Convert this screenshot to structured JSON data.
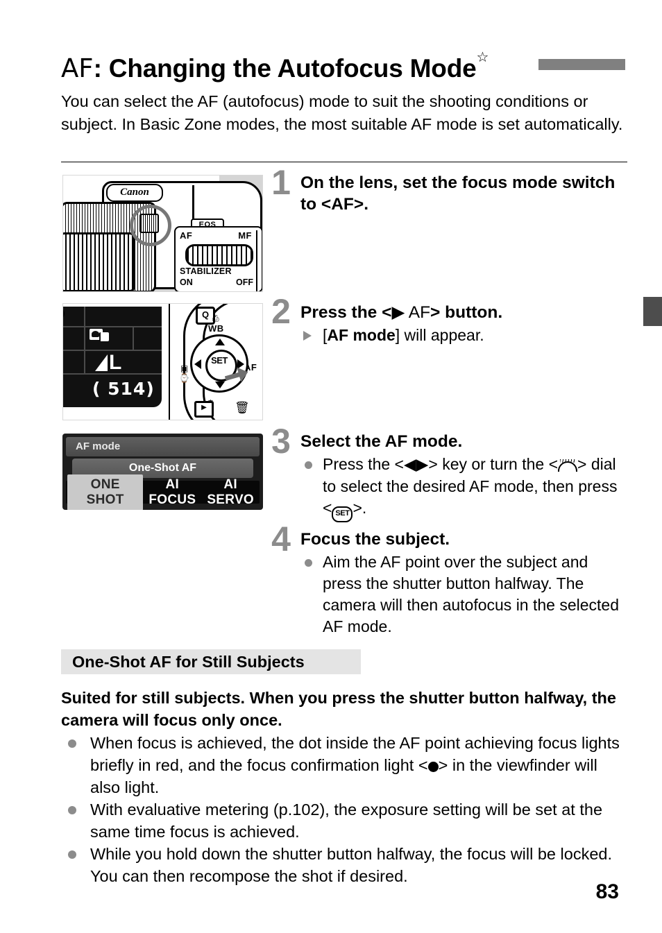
{
  "header": {
    "af_glyph": "AF",
    "title": ": Changing the Autofocus Mode",
    "star": "☆"
  },
  "intro": "You can select the AF (autofocus) mode to suit the shooting conditions or subject. In Basic Zone modes, the most suitable AF mode is set automatically.",
  "steps": [
    {
      "number": "1",
      "heading": "On the lens, set the focus mode switch to <AF>.",
      "body": []
    },
    {
      "number": "2",
      "heading_pre": "Press the <",
      "heading_arrow": "▶",
      "heading_af": " AF",
      "heading_post": "> button.",
      "body": [
        {
          "marker": "triangle",
          "pre": "[",
          "bold": "AF mode",
          "post": "] will appear."
        }
      ]
    },
    {
      "number": "3",
      "heading": "Select the AF mode.",
      "body": [
        {
          "marker": "dot",
          "seg1": "Press the <",
          "arrows": "◀▶",
          "seg2": "> key or turn the <",
          "dial": "main-dial-icon",
          "seg3": "> dial to select the desired AF mode, then press <",
          "set": "SET",
          "seg4": ">."
        }
      ]
    },
    {
      "number": "4",
      "heading": "Focus the subject.",
      "body": [
        {
          "marker": "dot",
          "text": "Aim the AF point over the subject and press the shutter button halfway. The camera will then autofocus in the selected AF mode."
        }
      ]
    }
  ],
  "figures": {
    "camera": {
      "brand": "Canon",
      "eos": "EOS",
      "switch_af": "AF",
      "switch_mf": "MF",
      "stabilizer": "STABILIZER",
      "stabilizer_on": "ON",
      "stabilizer_off": "OFF"
    },
    "lcd": {
      "quality": "L",
      "shots_remaining": "( 514)"
    },
    "controls": {
      "q_button": "Q",
      "wb_label": "WB",
      "af_label": "AF"
    },
    "af_mode_screen": {
      "header": "AF mode",
      "selected_label": "One-Shot AF",
      "options": [
        "ONE SHOT",
        "AI FOCUS",
        "AI SERVO"
      ],
      "active_option": "ONE SHOT"
    }
  },
  "section": {
    "heading": "One-Shot AF for Still Subjects",
    "lead": "Suited for still subjects. When you press the shutter button halfway, the camera will focus only once.",
    "notes": [
      {
        "seg1": "When focus is achieved, the dot inside the AF point achieving focus lights briefly in red, and the focus confirmation light <",
        "icon": "focus-confirm-dot",
        "seg2": "> in the viewfinder will also light."
      },
      {
        "text": "With evaluative metering (p.102), the exposure setting will be set at the same time focus is achieved."
      },
      {
        "text": "While you hold down the shutter button halfway, the focus will be locked. You can then recompose the shot if desired."
      }
    ]
  },
  "page_number": "83",
  "colors": {
    "header_bar": "#808080",
    "tab_marker": "#4d4d4d",
    "step_number": "#8c8c8c",
    "section_heading_bg": "#e4e4e4"
  }
}
